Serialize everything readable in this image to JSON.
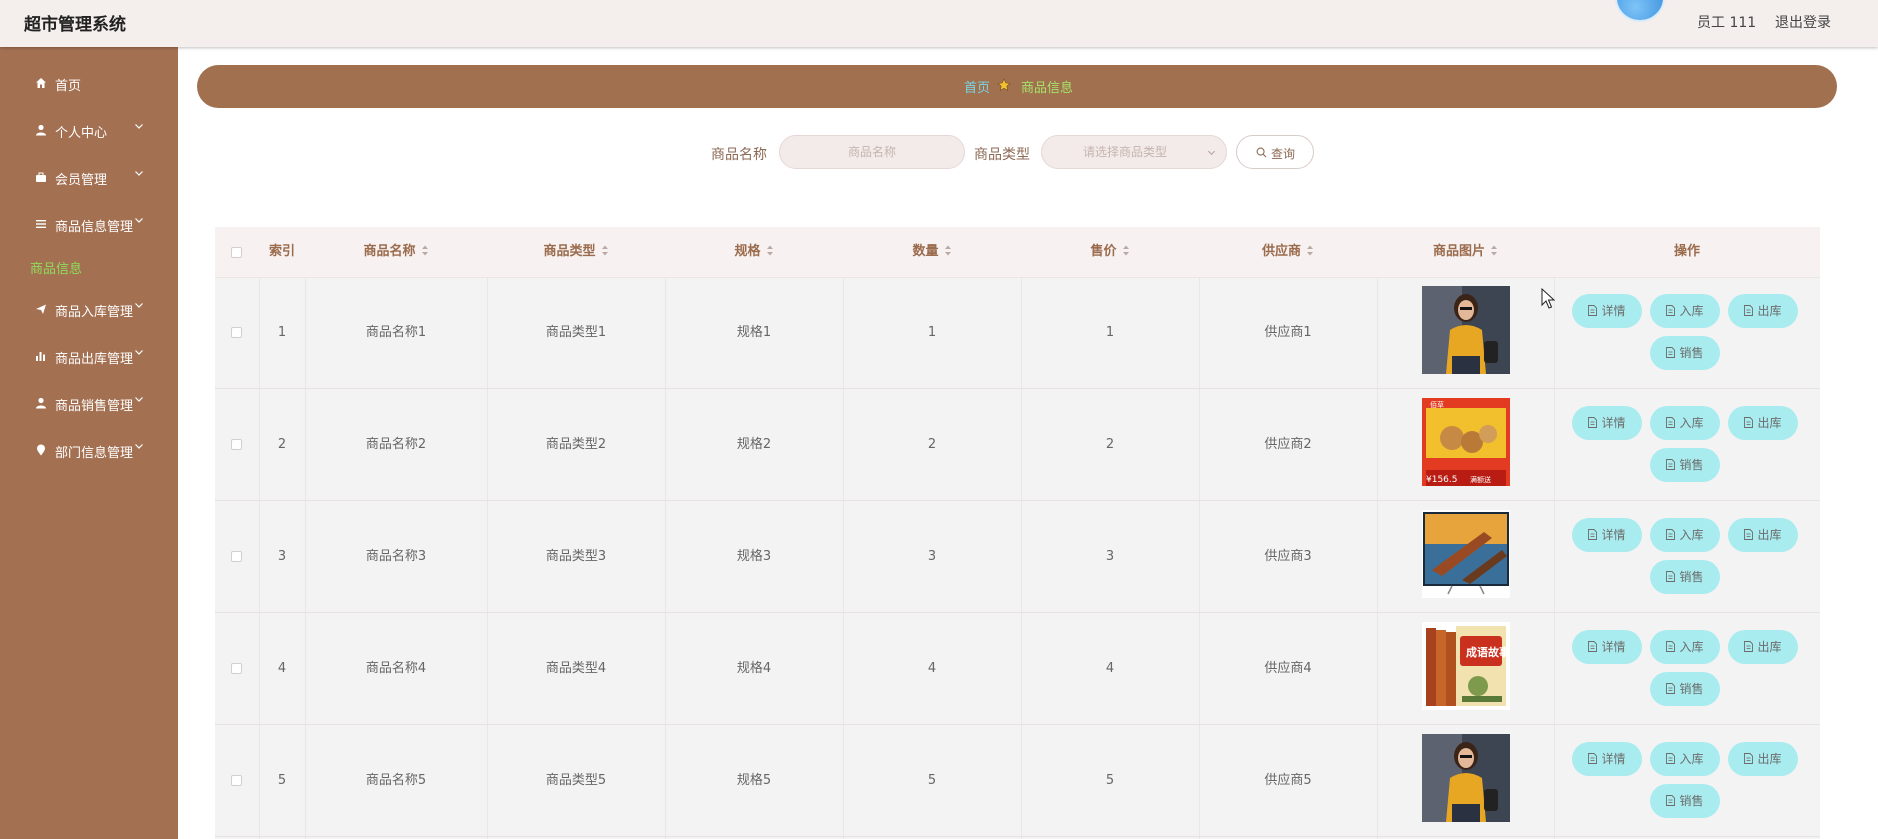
{
  "header": {
    "title": "超市管理系统",
    "user": "员工 111",
    "logout": "退出登录"
  },
  "sidebar": {
    "items": [
      {
        "label": "首页",
        "icon": "home-icon"
      },
      {
        "label": "个人中心",
        "icon": "user-icon"
      },
      {
        "label": "会员管理",
        "icon": "briefcase-icon"
      },
      {
        "label": "商品信息管理",
        "icon": "list-icon"
      },
      {
        "label": "商品入库管理",
        "icon": "send-icon"
      },
      {
        "label": "商品出库管理",
        "icon": "bar-chart-icon"
      },
      {
        "label": "商品销售管理",
        "icon": "user-icon"
      },
      {
        "label": "部门信息管理",
        "icon": "location-icon"
      }
    ],
    "active_sub": "商品信息"
  },
  "breadcrumb": {
    "home": "首页",
    "current": "商品信息"
  },
  "search": {
    "name_label": "商品名称",
    "name_placeholder": "商品名称",
    "type_label": "商品类型",
    "type_placeholder": "请选择商品类型",
    "button": "查询"
  },
  "table": {
    "columns": [
      "索引",
      "商品名称",
      "商品类型",
      "规格",
      "数量",
      "售价",
      "供应商",
      "商品图片",
      "操作"
    ],
    "actions": [
      "详情",
      "入库",
      "出库",
      "销售"
    ],
    "rows": [
      {
        "index": "1",
        "name": "商品名称1",
        "type": "商品类型1",
        "spec": "规格1",
        "qty": "1",
        "price": "1",
        "supplier": "供应商1",
        "image": "woman-photo"
      },
      {
        "index": "2",
        "name": "商品名称2",
        "type": "商品类型2",
        "spec": "规格2",
        "qty": "2",
        "price": "2",
        "supplier": "供应商2",
        "image": "snack-box-photo"
      },
      {
        "index": "3",
        "name": "商品名称3",
        "type": "商品类型3",
        "spec": "规格3",
        "qty": "3",
        "price": "3",
        "supplier": "供应商3",
        "image": "tv-photo"
      },
      {
        "index": "4",
        "name": "商品名称4",
        "type": "商品类型4",
        "spec": "规格4",
        "qty": "4",
        "price": "4",
        "supplier": "供应商4",
        "image": "book-set-photo"
      },
      {
        "index": "5",
        "name": "商品名称5",
        "type": "商品类型5",
        "spec": "规格5",
        "qty": "5",
        "price": "5",
        "supplier": "供应商5",
        "image": "woman-photo"
      }
    ]
  },
  "images": {
    "snack_box": {
      "brand": "佰草",
      "price": "¥156.5",
      "promo": "满额送"
    },
    "book_set": {
      "title": "成语故事"
    }
  },
  "colors": {
    "sidebar": "#a47052",
    "breadcrumb_bar": "#a0704f",
    "action_button": "#a9ecef",
    "header_text": "#9b6b4d"
  }
}
